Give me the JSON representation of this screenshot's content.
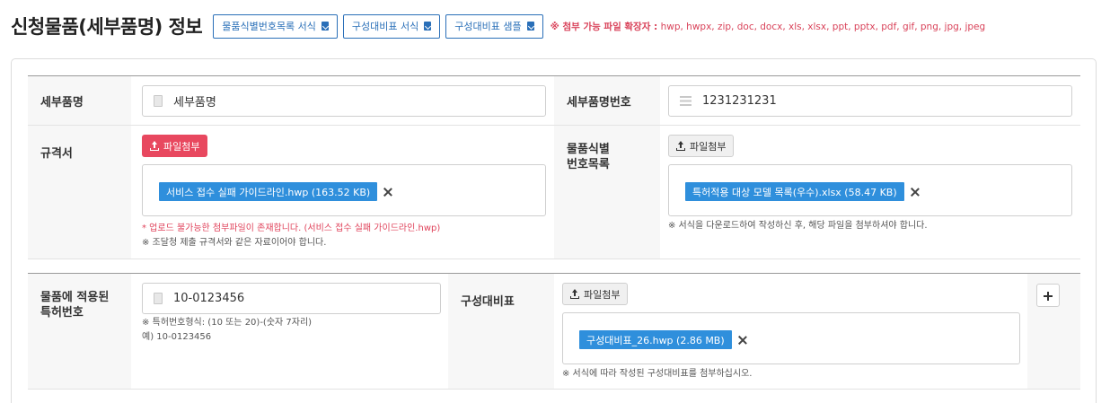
{
  "header": {
    "title": "신청물품(세부품명) 정보",
    "buttons": [
      "물품식별번호목록 서식",
      "구성대비표 서식",
      "구성대비표 샘플"
    ],
    "notice_label": "※ 첨부 가능 파일 확장자 :",
    "notice_exts": "hwp, hwpx, zip, doc, docx, xls, xlsx, ppt, pptx, pdf, gif, png, jpg, jpeg"
  },
  "row1": {
    "detail_name_label": "세부품명",
    "detail_name_value": "세부품명",
    "detail_no_label": "세부품명번호",
    "detail_no_value": "1231231231"
  },
  "row2": {
    "spec_label": "규격서",
    "spec_attach": "파일첨부",
    "spec_file": "서비스 접수 실패 가이드라인.hwp (163.52 KB)",
    "spec_error": "* 업로드 불가능한 첨부파일이 존재합니다. (서비스 접수 실패 가이드라인.hwp)",
    "spec_help": "※ 조달청 제출 규격서와 같은 자료이어야 합니다.",
    "idlist_label_1": "물품식별",
    "idlist_label_2": "번호목록",
    "idlist_attach": "파일첨부",
    "idlist_file": "특허적용 대상 모델 목록(우수).xlsx (58.47 KB)",
    "idlist_help": "※ 서식을 다운로드하여 작성하신 후, 해당 파일을 첨부하셔야 합니다."
  },
  "row3": {
    "patent_label_1": "물품에 적용된",
    "patent_label_2": "특허번호",
    "patent_value": "10-0123456",
    "patent_help_1": "※ 특허번호형식: (10 또는 20)-(숫자 7자리)",
    "patent_help_2": "예) 10-0123456",
    "compare_label": "구성대비표",
    "compare_attach": "파일첨부",
    "compare_file": "구성대비표_26.hwp (2.86 MB)",
    "compare_help": "※ 서식에 따라 작성된 구성대비표를 첨부하십시오."
  }
}
